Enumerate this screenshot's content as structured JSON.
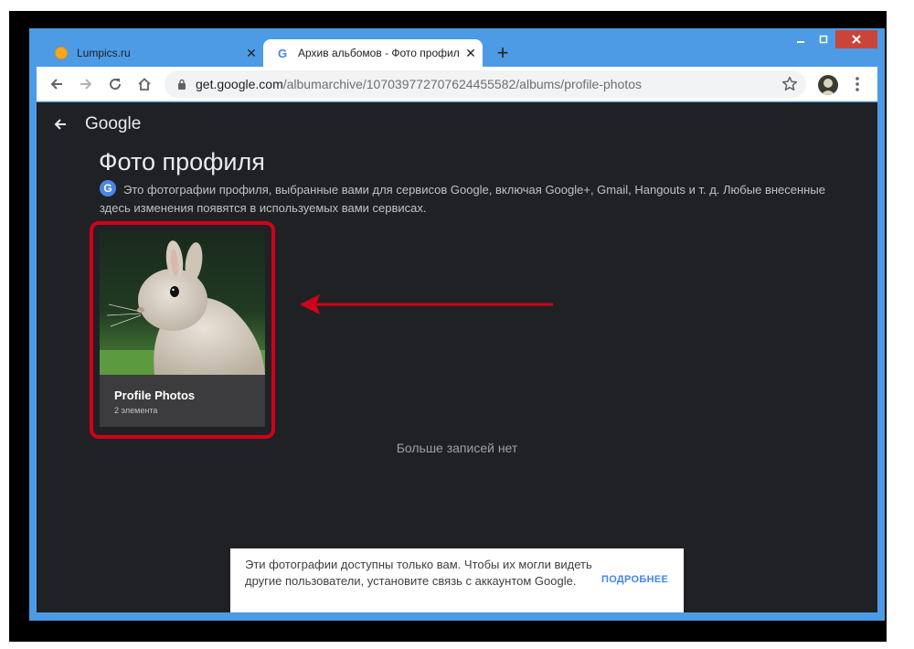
{
  "browser": {
    "tabs": [
      {
        "title": "Lumpics.ru",
        "active": false
      },
      {
        "title": "Архив альбомов - Фото профиля",
        "active": true
      }
    ],
    "new_tab_symbol": "+",
    "address": {
      "host": "get.google.com",
      "path": "/albumarchive/107039772707624455582/albums/profile-photos"
    },
    "icons": {
      "back": "back-arrow-icon",
      "forward": "forward-arrow-icon",
      "reload": "reload-icon",
      "home": "home-icon",
      "lock": "lock-icon",
      "star": "star-icon",
      "menu": "kebab-menu-icon"
    },
    "colors": {
      "frame": "#4c9be4",
      "close_button": "#c9453a"
    }
  },
  "page": {
    "brand": "Google",
    "title": "Фото профиля",
    "description": "Это фотографии профиля, выбранные вами для сервисов Google, включая Google+, Gmail, Hangouts и т. д. Любые внесенные здесь изменения появятся в используемых вами сервисах.",
    "album": {
      "name": "Profile Photos",
      "count": "2 элемента"
    },
    "empty_message": "Больше записей нет",
    "colors": {
      "background": "#202124",
      "highlight": "#d0021b"
    }
  },
  "snackbar": {
    "text": "Эти фотографии доступны только вам. Чтобы их могли видеть другие пользователи, установите связь с аккаунтом Google.",
    "link": "ПОДРОБНЕЕ"
  }
}
